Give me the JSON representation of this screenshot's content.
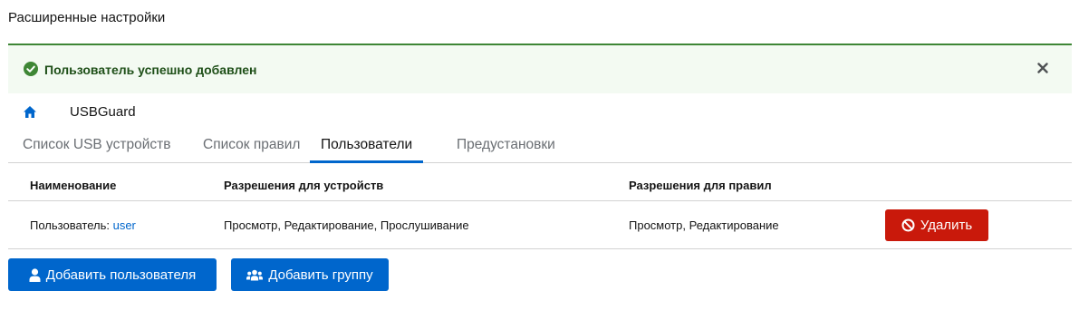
{
  "page": {
    "title": "Расширенные настройки"
  },
  "alert": {
    "message": "Пользователь успешно добавлен",
    "icon": "check-circle-icon",
    "close_icon": "close-icon",
    "color": "#3e8635"
  },
  "breadcrumb": {
    "app_name": "USBGuard",
    "icon": "home-icon"
  },
  "tabs": [
    {
      "label": "Список USB устройств",
      "active": false
    },
    {
      "label": "Список правил",
      "active": false
    },
    {
      "label": "Пользователи",
      "active": true
    },
    {
      "label": "Предустановки",
      "active": false
    }
  ],
  "table": {
    "headers": [
      "Наименование",
      "Разрешения для устройств",
      "Разрешения для правил"
    ],
    "rows": [
      {
        "name_prefix": "Пользователь: ",
        "name_link": "user",
        "device_permissions": "Просмотр, Редактирование, Прослушивание",
        "rule_permissions": "Просмотр, Редактирование",
        "delete_label": "Удалить"
      }
    ]
  },
  "actions": {
    "add_user_label": "Добавить пользователя",
    "add_group_label": "Добавить группу"
  },
  "colors": {
    "primary": "#0066cc",
    "danger": "#c9190b",
    "success": "#3e8635"
  }
}
